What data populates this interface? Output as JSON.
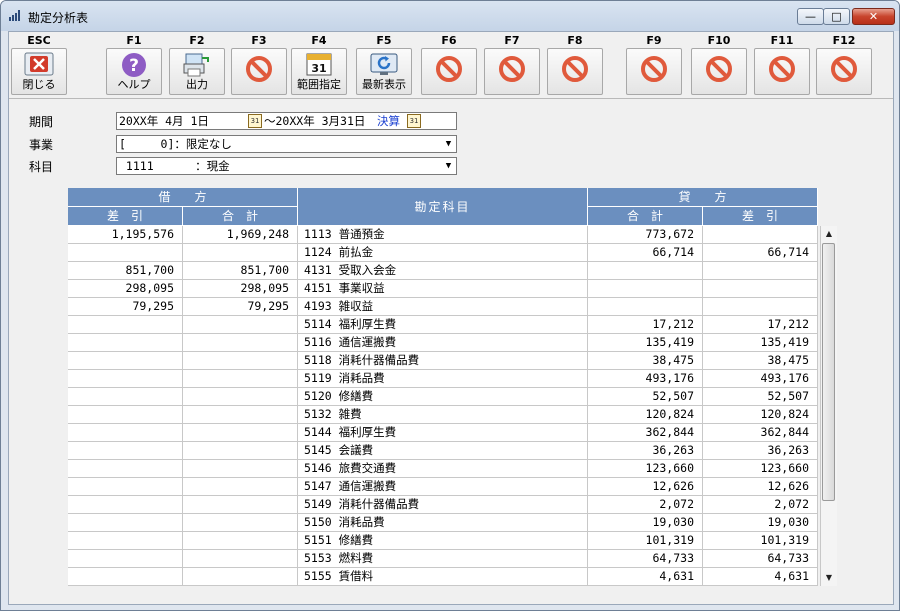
{
  "window": {
    "title": "勘定分析表",
    "controls": {
      "minimize": "—",
      "maximize": "□",
      "close": "✕"
    }
  },
  "toolbar": [
    {
      "key": "ESC",
      "label": "閉じる",
      "icon": "close-x-icon"
    },
    {
      "key": "F1",
      "label": "ヘルプ",
      "icon": "help-icon"
    },
    {
      "key": "F2",
      "label": "出力",
      "icon": "output-icon"
    },
    {
      "key": "F3",
      "label": "",
      "icon": "prohibited-icon"
    },
    {
      "key": "F4",
      "label": "範囲指定",
      "icon": "calendar-icon"
    },
    {
      "key": "F5",
      "label": "最新表示",
      "icon": "refresh-icon"
    },
    {
      "key": "F6",
      "label": "",
      "icon": "prohibited-icon"
    },
    {
      "key": "F7",
      "label": "",
      "icon": "prohibited-icon"
    },
    {
      "key": "F8",
      "label": "",
      "icon": "prohibited-icon"
    },
    {
      "key": "F9",
      "label": "",
      "icon": "prohibited-icon"
    },
    {
      "key": "F10",
      "label": "",
      "icon": "prohibited-icon"
    },
    {
      "key": "F11",
      "label": "",
      "icon": "prohibited-icon"
    },
    {
      "key": "F12",
      "label": "",
      "icon": "prohibited-icon"
    }
  ],
  "form": {
    "period_label": "期間",
    "period_from": "20XX年 4月 1日",
    "period_to_prefix": "～20XX年 3月31日",
    "period_settlement": "決算",
    "business_label": "事業",
    "business_value": "[     0]：限定なし",
    "account_label": "科目",
    "account_value": " 1111      ：現金",
    "calendar_glyph": "31"
  },
  "table": {
    "headers": {
      "debit": "借　　方",
      "debit_diff": "差　引",
      "debit_total": "合　計",
      "account": "勘定科目",
      "credit": "貸　　方",
      "credit_total": "合　計",
      "credit_diff": "差　引"
    },
    "rows": [
      {
        "debit_diff": "1,195,576",
        "debit_total": "1,969,248",
        "account": "1113 普通預金",
        "credit_total": "773,672",
        "credit_diff": ""
      },
      {
        "debit_diff": "",
        "debit_total": "",
        "account": "1124 前払金",
        "credit_total": "66,714",
        "credit_diff": "66,714"
      },
      {
        "debit_diff": "851,700",
        "debit_total": "851,700",
        "account": "4131 受取入会金",
        "credit_total": "",
        "credit_diff": ""
      },
      {
        "debit_diff": "298,095",
        "debit_total": "298,095",
        "account": "4151 事業収益",
        "credit_total": "",
        "credit_diff": ""
      },
      {
        "debit_diff": "79,295",
        "debit_total": "79,295",
        "account": "4193 雑収益",
        "credit_total": "",
        "credit_diff": ""
      },
      {
        "debit_diff": "",
        "debit_total": "",
        "account": "5114 福利厚生費",
        "credit_total": "17,212",
        "credit_diff": "17,212"
      },
      {
        "debit_diff": "",
        "debit_total": "",
        "account": "5116 通信運搬費",
        "credit_total": "135,419",
        "credit_diff": "135,419"
      },
      {
        "debit_diff": "",
        "debit_total": "",
        "account": "5118 消耗什器備品費",
        "credit_total": "38,475",
        "credit_diff": "38,475"
      },
      {
        "debit_diff": "",
        "debit_total": "",
        "account": "5119 消耗品費",
        "credit_total": "493,176",
        "credit_diff": "493,176"
      },
      {
        "debit_diff": "",
        "debit_total": "",
        "account": "5120 修繕費",
        "credit_total": "52,507",
        "credit_diff": "52,507"
      },
      {
        "debit_diff": "",
        "debit_total": "",
        "account": "5132 雑費",
        "credit_total": "120,824",
        "credit_diff": "120,824"
      },
      {
        "debit_diff": "",
        "debit_total": "",
        "account": "5144 福利厚生費",
        "credit_total": "362,844",
        "credit_diff": "362,844"
      },
      {
        "debit_diff": "",
        "debit_total": "",
        "account": "5145 会議費",
        "credit_total": "36,263",
        "credit_diff": "36,263"
      },
      {
        "debit_diff": "",
        "debit_total": "",
        "account": "5146 旅費交通費",
        "credit_total": "123,660",
        "credit_diff": "123,660"
      },
      {
        "debit_diff": "",
        "debit_total": "",
        "account": "5147 通信運搬費",
        "credit_total": "12,626",
        "credit_diff": "12,626"
      },
      {
        "debit_diff": "",
        "debit_total": "",
        "account": "5149 消耗什器備品費",
        "credit_total": "2,072",
        "credit_diff": "2,072"
      },
      {
        "debit_diff": "",
        "debit_total": "",
        "account": "5150 消耗品費",
        "credit_total": "19,030",
        "credit_diff": "19,030"
      },
      {
        "debit_diff": "",
        "debit_total": "",
        "account": "5151 修繕費",
        "credit_total": "101,319",
        "credit_diff": "101,319"
      },
      {
        "debit_diff": "",
        "debit_total": "",
        "account": "5153 燃料費",
        "credit_total": "64,733",
        "credit_diff": "64,733"
      },
      {
        "debit_diff": "",
        "debit_total": "",
        "account": "5155 賃借料",
        "credit_total": "4,631",
        "credit_diff": "4,631"
      }
    ]
  },
  "scrollbar": {
    "up": "▲",
    "down": "▼"
  },
  "colors": {
    "header_bg": "#6b8fbf",
    "prohibited": "#e05a3c",
    "help": "#8e5cc4",
    "close_red": "#d23b2b",
    "refresh": "#2a73c8"
  }
}
